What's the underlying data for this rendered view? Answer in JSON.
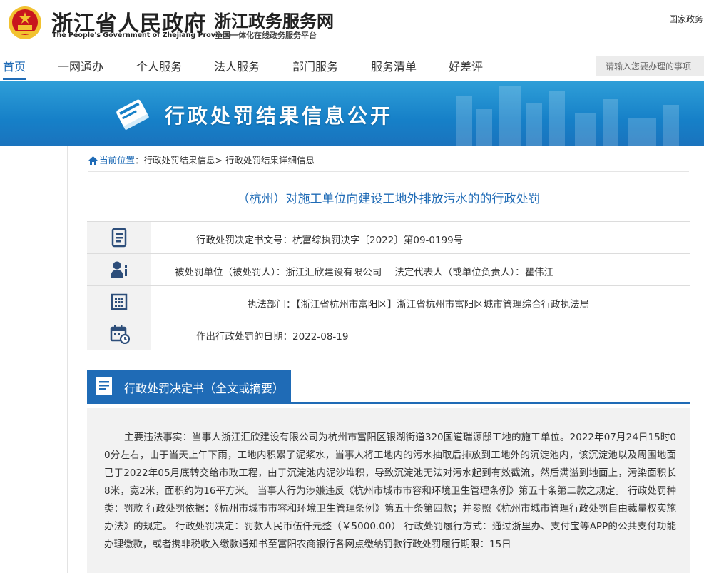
{
  "header": {
    "gov_name_cn": "浙江省人民政府",
    "gov_name_en": "The People's Government of Zhejiang Province",
    "service_name": "浙江政务服务网",
    "service_subtitle": "全国一体化在线政务服务平台",
    "top_link": "国家政务",
    "emblem_icon": "national-emblem-icon"
  },
  "nav": {
    "items": [
      {
        "label": "首页",
        "active": true
      },
      {
        "label": "一网通办"
      },
      {
        "label": "个人服务"
      },
      {
        "label": "法人服务"
      },
      {
        "label": "部门服务"
      },
      {
        "label": "服务清单"
      },
      {
        "label": "好差评"
      }
    ],
    "search_placeholder": "请输入您要办理的事项"
  },
  "banner": {
    "title": "行政处罚结果信息公开",
    "icon": "book-icon"
  },
  "breadcrumb": {
    "current_label": "当前位置",
    "sep1": "：",
    "item1": "行政处罚结果信息",
    "sep2": "> ",
    "item2": "行政处罚结果详细信息"
  },
  "page_title": "（杭州）对施工单位向建设工地外排放污水的的行政处罚",
  "info_rows": [
    {
      "icon": "document-icon",
      "label": "行政处罚决定书文号：",
      "value": "杭富综执罚决字〔2022〕第09-0199号"
    },
    {
      "icon": "person-icon",
      "label": "被处罚单位（被处罚人）：",
      "value": "浙江汇欣建设有限公司",
      "label2": "法定代表人（或单位负责人）：",
      "value2": "瞿伟江"
    },
    {
      "icon": "building-icon",
      "label": "执法部门：",
      "value": "【浙江省杭州市富阳区】浙江省杭州市富阳区城市管理综合行政执法局"
    },
    {
      "icon": "calendar-icon",
      "label": "作出行政处罚的日期：",
      "value": "2022-08-19"
    }
  ],
  "decision_section": {
    "heading": "行政处罚决定书（全文或摘要）",
    "icon": "list-document-icon",
    "body": "主要违法事实：当事人浙江汇欣建设有限公司为杭州市富阳区银湖街道320国道瑞源邸工地的施工单位。2022年07月24日15时00分左右，由于当天上午下雨，工地内积累了泥浆水，当事人将工地内的污水抽取后排放到工地外的沉淀池内，该沉淀池以及周围地面已于2022年05月底转交给市政工程，由于沉淀池内泥沙堆积，导致沉淀池无法对污水起到有效截流，然后满溢到地面上，污染面积长8米，宽2米，面积约为16平方米。 当事人行为涉嫌违反《杭州市城市市容和环境卫生管理条例》第五十条第二款之规定。 行政处罚种类：罚款 行政处罚依据：《杭州市城市市容和环境卫生管理条例》第五十条第四款；并参照《杭州市城市管理行政处罚自由裁量权实施办法》的规定。 行政处罚决定：罚款人民币伍仟元整（￥5000.00） 行政处罚履行方式：通过浙里办、支付宝等APP的公共支付功能办理缴款，或者携非税收入缴款通知书至富阳农商银行各网点缴纳罚款行政处罚履行期限：15日"
  },
  "colors": {
    "accent": "#1f6bb6",
    "banner": "#1680c8",
    "emblem_red": "#c8161d",
    "emblem_gold": "#f2c230"
  }
}
